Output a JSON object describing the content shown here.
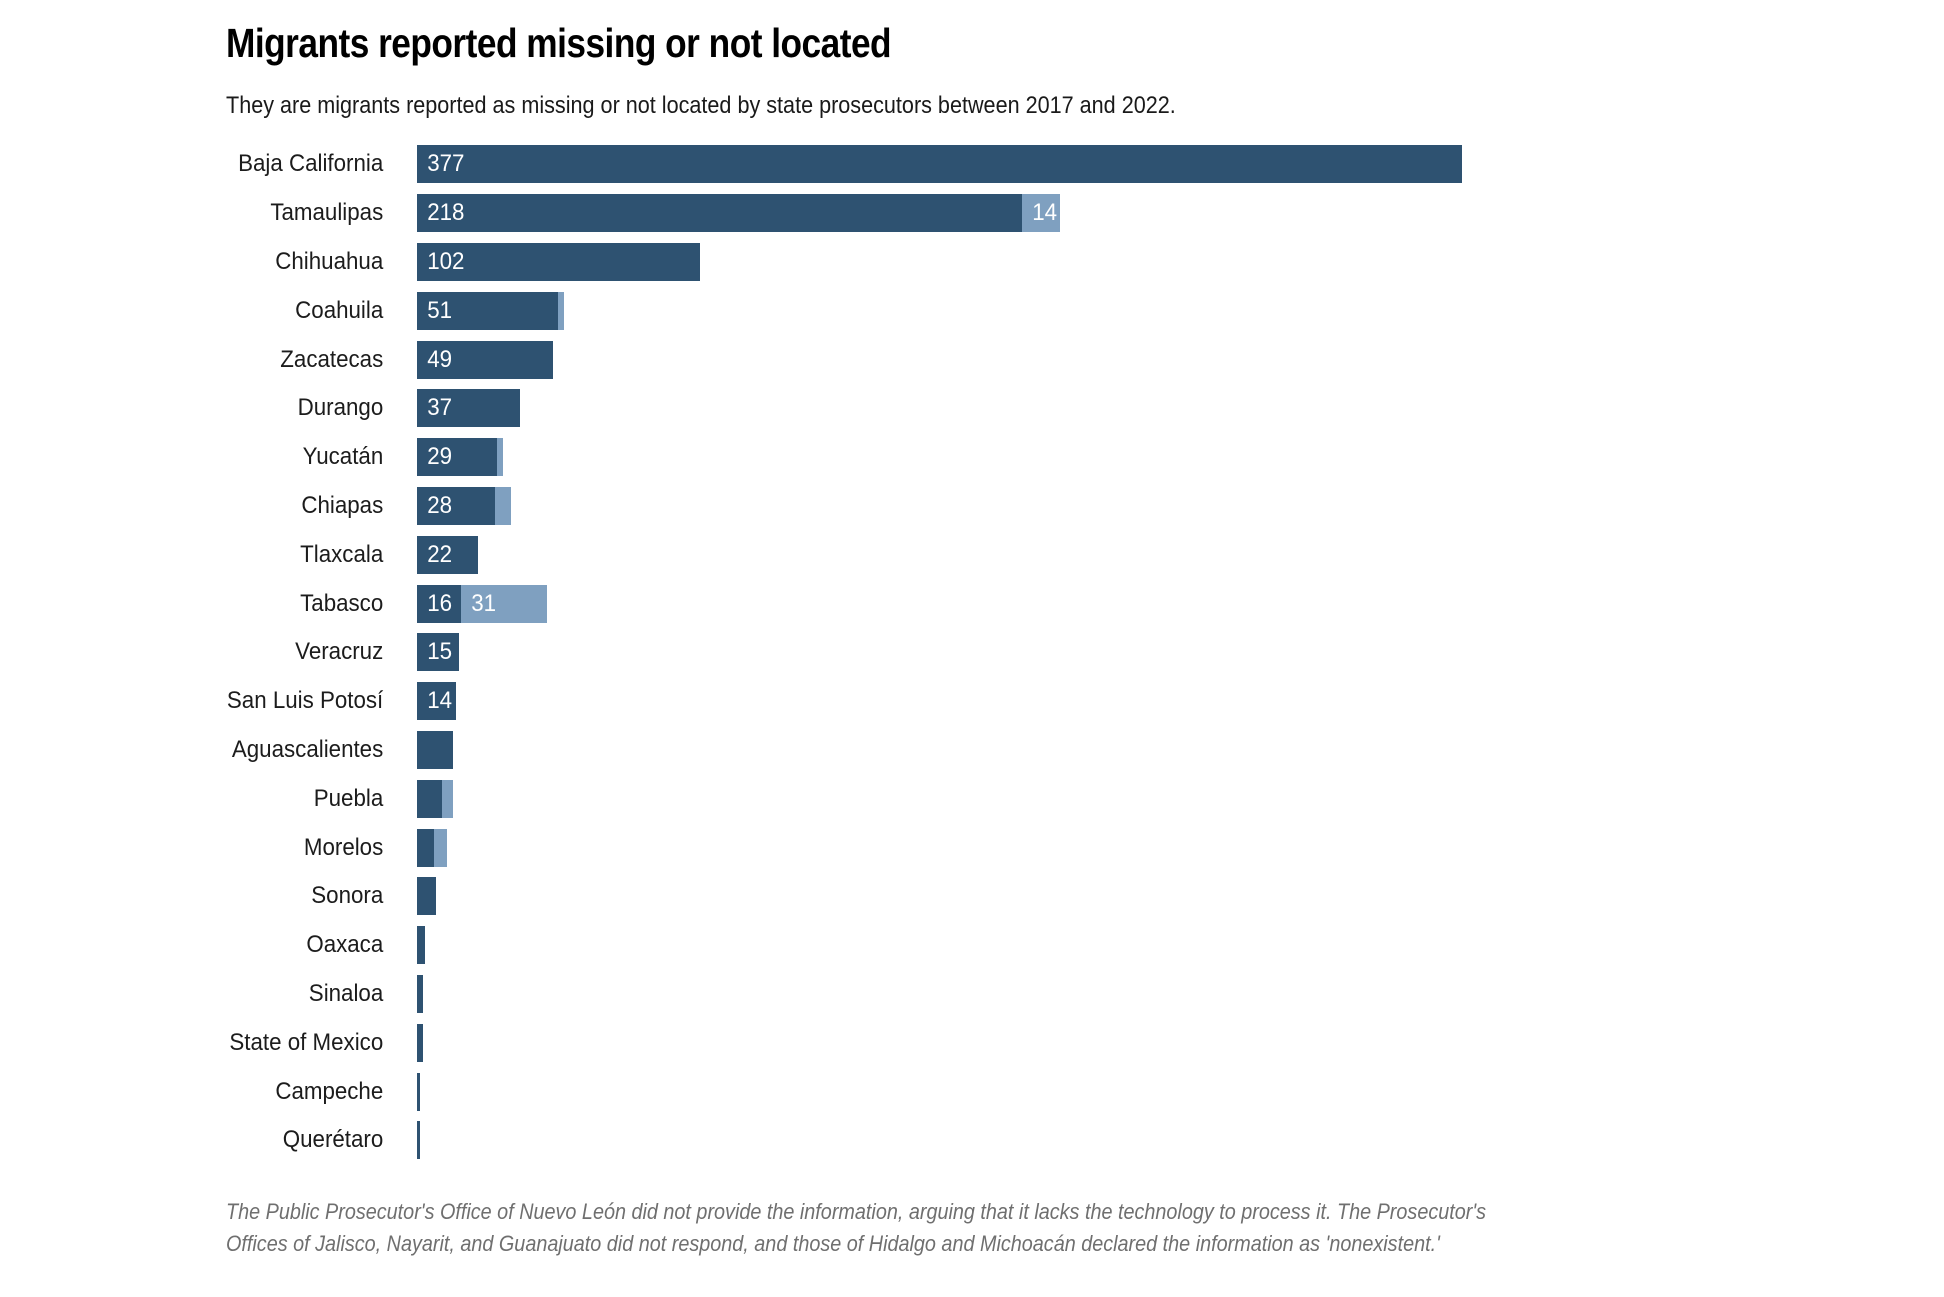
{
  "header": {
    "title": "Migrants reported missing or not located",
    "subtitle": "They are migrants reported as missing or not located by state prosecutors between 2017 and 2022."
  },
  "footnote": {
    "text": "The Public Prosecutor's Office of Nuevo León did not provide the information, arguing that it lacks the technology to process it. The Prosecutor's Offices of Jalisco, Nayarit, and Guanajuato did not respond, and those of Hidalgo and Michoacán declared the information as 'nonexistent.'"
  },
  "chart_data": {
    "type": "bar",
    "orientation": "horizontal",
    "stacked": true,
    "title": "Migrants reported missing or not located",
    "subtitle": "They are migrants reported as missing or not located by state prosecutors between 2017 and 2022.",
    "xlabel": "",
    "ylabel": "",
    "grid": false,
    "legend": "none",
    "axis_visible": false,
    "xlim": [
      0,
      377
    ],
    "colors": {
      "missing": "#2e5271",
      "not_located": "#7fa0c0",
      "value_label": "#ffffff",
      "category_label": "#1c1c1c",
      "footnote": "#6f6f6f",
      "background": "#ffffff"
    },
    "categories": [
      "Baja California",
      "Tamaulipas",
      "Chihuahua",
      "Coahuila",
      "Zacatecas",
      "Durango",
      "Yucatán",
      "Chiapas",
      "Tlaxcala",
      "Tabasco",
      "Veracruz",
      "San Luis Potosí",
      "Aguascalientes",
      "Puebla",
      "Morelos",
      "Sonora",
      "Oaxaca",
      "Sinaloa",
      "State of Mexico",
      "Campeche",
      "Querétaro"
    ],
    "series": [
      {
        "name": "missing",
        "values": [
          377,
          218,
          102,
          51,
          49,
          37,
          29,
          28,
          22,
          16,
          15,
          14,
          13,
          9,
          6,
          7,
          3,
          2,
          2,
          1,
          1
        ]
      },
      {
        "name": "not_located",
        "values": [
          0,
          14,
          0,
          2,
          0,
          0,
          2,
          6,
          0,
          31,
          0,
          0,
          0,
          4,
          5,
          0,
          0,
          0,
          0,
          0,
          0
        ]
      }
    ],
    "rows": [
      {
        "category": "Baja California",
        "missing": 377,
        "not_located": 0,
        "missing_label": "377",
        "not_located_label": ""
      },
      {
        "category": "Tamaulipas",
        "missing": 218,
        "not_located": 14,
        "missing_label": "218",
        "not_located_label": "14"
      },
      {
        "category": "Chihuahua",
        "missing": 102,
        "not_located": 0,
        "missing_label": "102",
        "not_located_label": ""
      },
      {
        "category": "Coahuila",
        "missing": 51,
        "not_located": 2,
        "missing_label": "51",
        "not_located_label": ""
      },
      {
        "category": "Zacatecas",
        "missing": 49,
        "not_located": 0,
        "missing_label": "49",
        "not_located_label": ""
      },
      {
        "category": "Durango",
        "missing": 37,
        "not_located": 0,
        "missing_label": "37",
        "not_located_label": ""
      },
      {
        "category": "Yucatán",
        "missing": 29,
        "not_located": 2,
        "missing_label": "29",
        "not_located_label": ""
      },
      {
        "category": "Chiapas",
        "missing": 28,
        "not_located": 6,
        "missing_label": "28",
        "not_located_label": ""
      },
      {
        "category": "Tlaxcala",
        "missing": 22,
        "not_located": 0,
        "missing_label": "22",
        "not_located_label": ""
      },
      {
        "category": "Tabasco",
        "missing": 16,
        "not_located": 31,
        "missing_label": "16",
        "not_located_label": "31"
      },
      {
        "category": "Veracruz",
        "missing": 15,
        "not_located": 0,
        "missing_label": "15",
        "not_located_label": ""
      },
      {
        "category": "San Luis Potosí",
        "missing": 14,
        "not_located": 0,
        "missing_label": "14",
        "not_located_label": ""
      },
      {
        "category": "Aguascalientes",
        "missing": 13,
        "not_located": 0,
        "missing_label": "",
        "not_located_label": ""
      },
      {
        "category": "Puebla",
        "missing": 9,
        "not_located": 4,
        "missing_label": "",
        "not_located_label": ""
      },
      {
        "category": "Morelos",
        "missing": 6,
        "not_located": 5,
        "missing_label": "",
        "not_located_label": ""
      },
      {
        "category": "Sonora",
        "missing": 7,
        "not_located": 0,
        "missing_label": "",
        "not_located_label": ""
      },
      {
        "category": "Oaxaca",
        "missing": 3,
        "not_located": 0,
        "missing_label": "",
        "not_located_label": ""
      },
      {
        "category": "Sinaloa",
        "missing": 2,
        "not_located": 0,
        "missing_label": "",
        "not_located_label": ""
      },
      {
        "category": "State of Mexico",
        "missing": 2,
        "not_located": 0,
        "missing_label": "",
        "not_located_label": ""
      },
      {
        "category": "Campeche",
        "missing": 1,
        "not_located": 0,
        "missing_label": "",
        "not_located_label": ""
      },
      {
        "category": "Querétaro",
        "missing": 1,
        "not_located": 0,
        "missing_label": "",
        "not_located_label": ""
      }
    ]
  }
}
